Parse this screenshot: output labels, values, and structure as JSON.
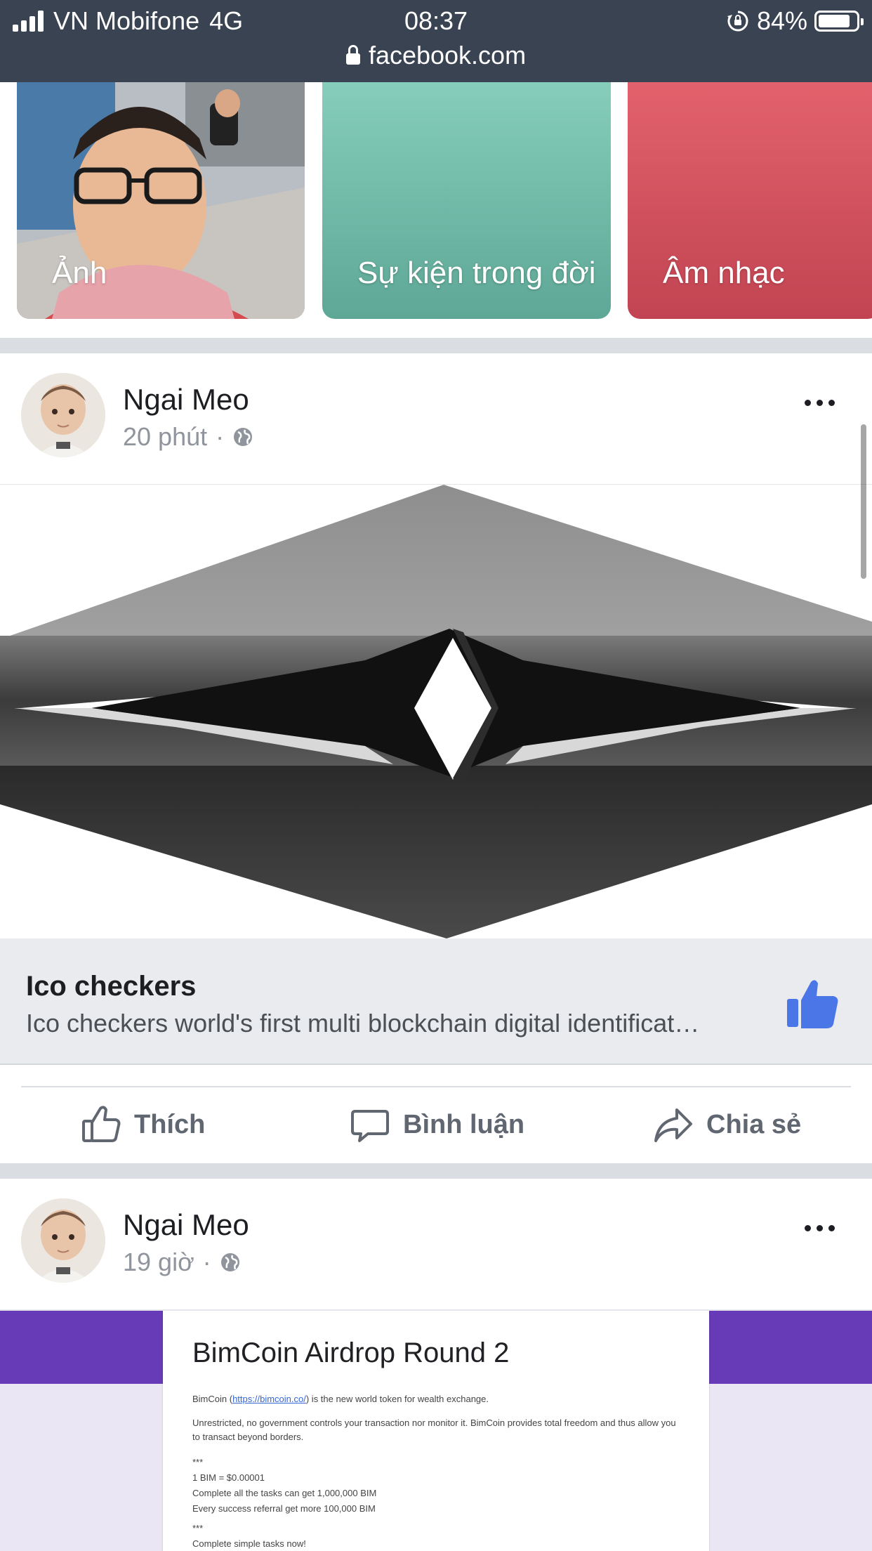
{
  "status_bar": {
    "carrier": "VN Mobifone",
    "network": "4G",
    "time": "08:37",
    "battery_percent": "84%",
    "battery_level": 0.84,
    "url": "facebook.com",
    "icons": [
      "signal-icon",
      "rotation-lock-icon",
      "battery-icon",
      "lock-icon"
    ]
  },
  "highlights": [
    {
      "label": "Ảnh"
    },
    {
      "label": "Sự kiện trong đời"
    },
    {
      "label": "Âm nhạc"
    }
  ],
  "posts": [
    {
      "author": "Ngai Meo",
      "time": "20 phút",
      "separator": "·",
      "link": {
        "title": "Ico checkers",
        "description": "Ico checkers world's first multi blockchain digital identificat…"
      }
    },
    {
      "author": "Ngai Meo",
      "time": "19 giờ",
      "separator": "·",
      "form": {
        "title": "BimCoin Airdrop Round 2",
        "intro_prefix": "BimCoin (",
        "intro_link": "https://bimcoin.co/",
        "intro_suffix": ") is the new world token for wealth exchange.",
        "para2": "Unrestricted, no government controls your transaction nor monitor it. BimCoin provides total freedom and thus allow you to transact beyond borders.",
        "stars1": "***",
        "rate": "1 BIM = $0.00001",
        "tasks": "Complete all the tasks can get 1,000,000 BIM",
        "referral": "Every success referral get more 100,000 BIM",
        "stars2": "***",
        "cta": "Complete simple tasks now!"
      }
    }
  ],
  "actions": {
    "like": "Thích",
    "comment": "Bình luận",
    "share": "Chia sẻ"
  },
  "colors": {
    "status_bar_bg": "#3a4352",
    "like_blue": "#4a76e8",
    "separator_gray": "#dadde1",
    "form_purple": "#673ab7"
  }
}
